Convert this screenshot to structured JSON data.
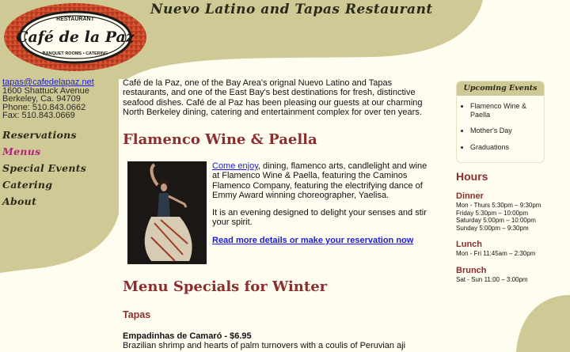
{
  "logo": {
    "top_text": "RESTAURANT",
    "name": "Café de la Paz",
    "bottom_text": "BANQUET ROOMS • CATERING"
  },
  "banner_title": "Nuevo Latino and Tapas Restaurant",
  "contact": {
    "email": "tapas@cafedelapaz.net",
    "address_line1": "1600 Shattuck Avenue",
    "address_line2": "Berkeley, Ca. 94709",
    "phone": "Phone: 510.843.0662",
    "fax": "Fax: 510.843.0669"
  },
  "nav": {
    "items": [
      {
        "label": "Reservations"
      },
      {
        "label": "Menus"
      },
      {
        "label": "Special Events"
      },
      {
        "label": "Catering"
      },
      {
        "label": "About"
      }
    ]
  },
  "intro": "Café de la Paz, one of the Bay Area's orignal Nuevo Latino and Tapas restaurants, and one of the East Bay's best destinations for fresh, distinctive seafood dishes. Café de al Paz has been pleasing our guests at our charming North Berkeley dining, catering and entertainment complex for over ten years.",
  "feature": {
    "title": "Flamenco Wine & Paella",
    "link_text": "Come enjoy",
    "text1": ", dining, flamenco arts, candlelight and wine at Flamenco Wine & Paella, featuring the Caminos Flamenco Company, featuring the electrifying dance of Emmy Award winning choreographer, Yaelisa.",
    "text2": "It is an evening designed to delight your senses and stir your spirit.",
    "more_link": "Read more details or make your reservation now"
  },
  "specials": {
    "title": "Menu Specials for Winter",
    "tapas_heading": "Tapas",
    "dish_name": "Empadinhas de Camaró - $6.95",
    "dish_desc": "Brazilian shrimp and hearts of palm turnovers with a coulis of Peruvian aji"
  },
  "events": {
    "header": "Upcoming Events",
    "items": [
      "Flamenco Wine & Paella",
      "Mother's Day",
      "Graduations"
    ]
  },
  "hours": {
    "title": "Hours",
    "dinner": {
      "head": "Dinner",
      "lines": [
        "Mon - Thurs 5:30pm – 9:30pm",
        "Friday 5:30pm – 10:00pm",
        "Saturday 5:00pm – 10:00pm",
        "Sunday 5:00pm – 9:30pm"
      ]
    },
    "lunch": {
      "head": "Lunch",
      "lines": [
        "Mon - Fri 11:45am – 2:30pm"
      ]
    },
    "brunch": {
      "head": "Brunch",
      "lines": [
        "Sat - Sun 11:00 – 3:00pm"
      ]
    }
  },
  "colors": {
    "background": "#fffdf0",
    "olive": "#cfc996",
    "heading_red": "#8b2e2e",
    "link_blue": "#1a1ae6",
    "nav_active": "#b0257a"
  }
}
